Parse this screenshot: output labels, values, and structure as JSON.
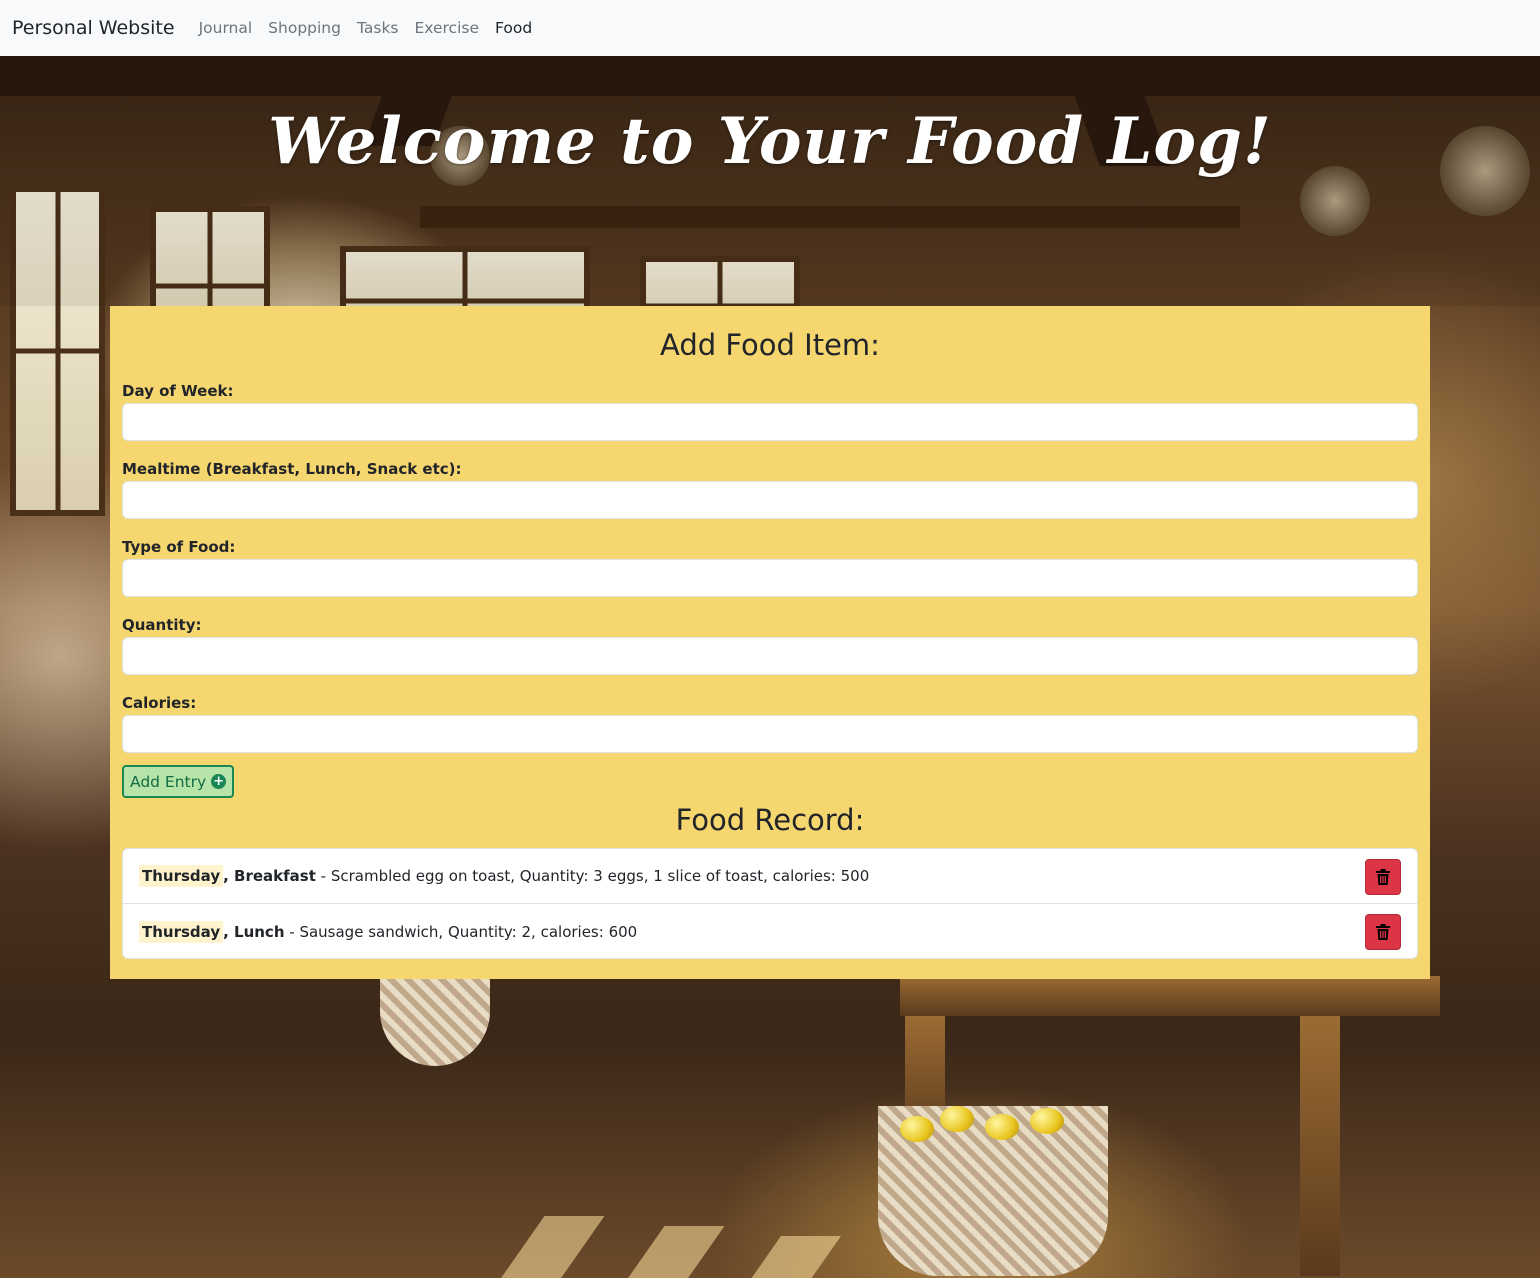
{
  "navbar": {
    "brand": "Personal Website",
    "links": [
      "Journal",
      "Shopping",
      "Tasks",
      "Exercise",
      "Food"
    ],
    "active": "Food"
  },
  "hero": {
    "title": "Welcome to Your Food Log!"
  },
  "form": {
    "heading": "Add Food Item:",
    "fields": [
      {
        "label": "Day of Week:",
        "value": ""
      },
      {
        "label": "Mealtime (Breakfast, Lunch, Snack etc):",
        "value": ""
      },
      {
        "label": "Type of Food:",
        "value": ""
      },
      {
        "label": "Quantity:",
        "value": ""
      },
      {
        "label": "Calories:",
        "value": ""
      }
    ],
    "add_button": "Add Entry"
  },
  "record": {
    "heading": "Food Record:",
    "entries": [
      {
        "day": "Thursday",
        "meal": ", Breakfast",
        "detail": " - Scrambled egg on toast, Quantity: 3 eggs, 1 slice of toast, calories: 500"
      },
      {
        "day": "Thursday",
        "meal": ", Lunch",
        "detail": " - Sausage sandwich, Quantity: 2, calories: 600"
      }
    ]
  },
  "colors": {
    "card": "#f6d66e",
    "add_button_border": "#198754",
    "delete_button": "#dc3545",
    "day_highlight": "#fff3cd"
  },
  "icons": {
    "add": "plus-circle-icon",
    "delete": "trash-icon"
  }
}
